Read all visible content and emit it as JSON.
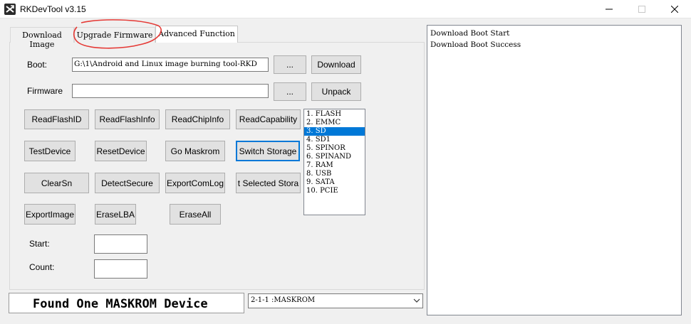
{
  "window": {
    "title": "RKDevTool v3.15"
  },
  "tabs": [
    {
      "label": "Download Image"
    },
    {
      "label": "Upgrade Firmware"
    },
    {
      "label": "Advanced Function"
    }
  ],
  "boot": {
    "label": "Boot:",
    "value": "G:\\1\\Android and Linux image burning tool-RKD",
    "browse_label": "...",
    "action_label": "Download"
  },
  "firmware": {
    "label": "Firmware",
    "value": "",
    "browse_label": "...",
    "action_label": "Unpack"
  },
  "buttons": {
    "read_flash_id": "ReadFlashID",
    "read_flash_info": "ReadFlashInfo",
    "read_chip_info": "ReadChipInfo",
    "read_capability": "ReadCapability",
    "test_device": "TestDevice",
    "reset_device": "ResetDevice",
    "go_maskrom": "Go Maskrom",
    "switch_storage": "Switch Storage",
    "clear_sn": "ClearSn",
    "detect_secure": "DetectSecure",
    "export_com_log": "ExportComLog",
    "selected_storage": "t Selected Stora",
    "export_image": "ExportImage",
    "erase_lba": "EraseLBA",
    "erase_all": "EraseAll"
  },
  "storage_list": {
    "items": [
      "1.  FLASH",
      "2.  EMMC",
      "3.  SD",
      "4.  SD1",
      "5.  SPINOR",
      "6.  SPINAND",
      "7.  RAM",
      "8.  USB",
      "9.  SATA",
      "10.  PCIE"
    ],
    "selected_index": 2
  },
  "range": {
    "start_label": "Start:",
    "start_value": "",
    "count_label": "Count:",
    "count_value": ""
  },
  "status": {
    "text": "Found One MASKROM Device"
  },
  "device_select": {
    "value": "2-1-1  :MASKROM"
  },
  "log": {
    "lines": [
      "Download Boot Start",
      "Download Boot Success"
    ]
  },
  "colors": {
    "accent": "#0078d7",
    "annotation": "#e53935"
  }
}
